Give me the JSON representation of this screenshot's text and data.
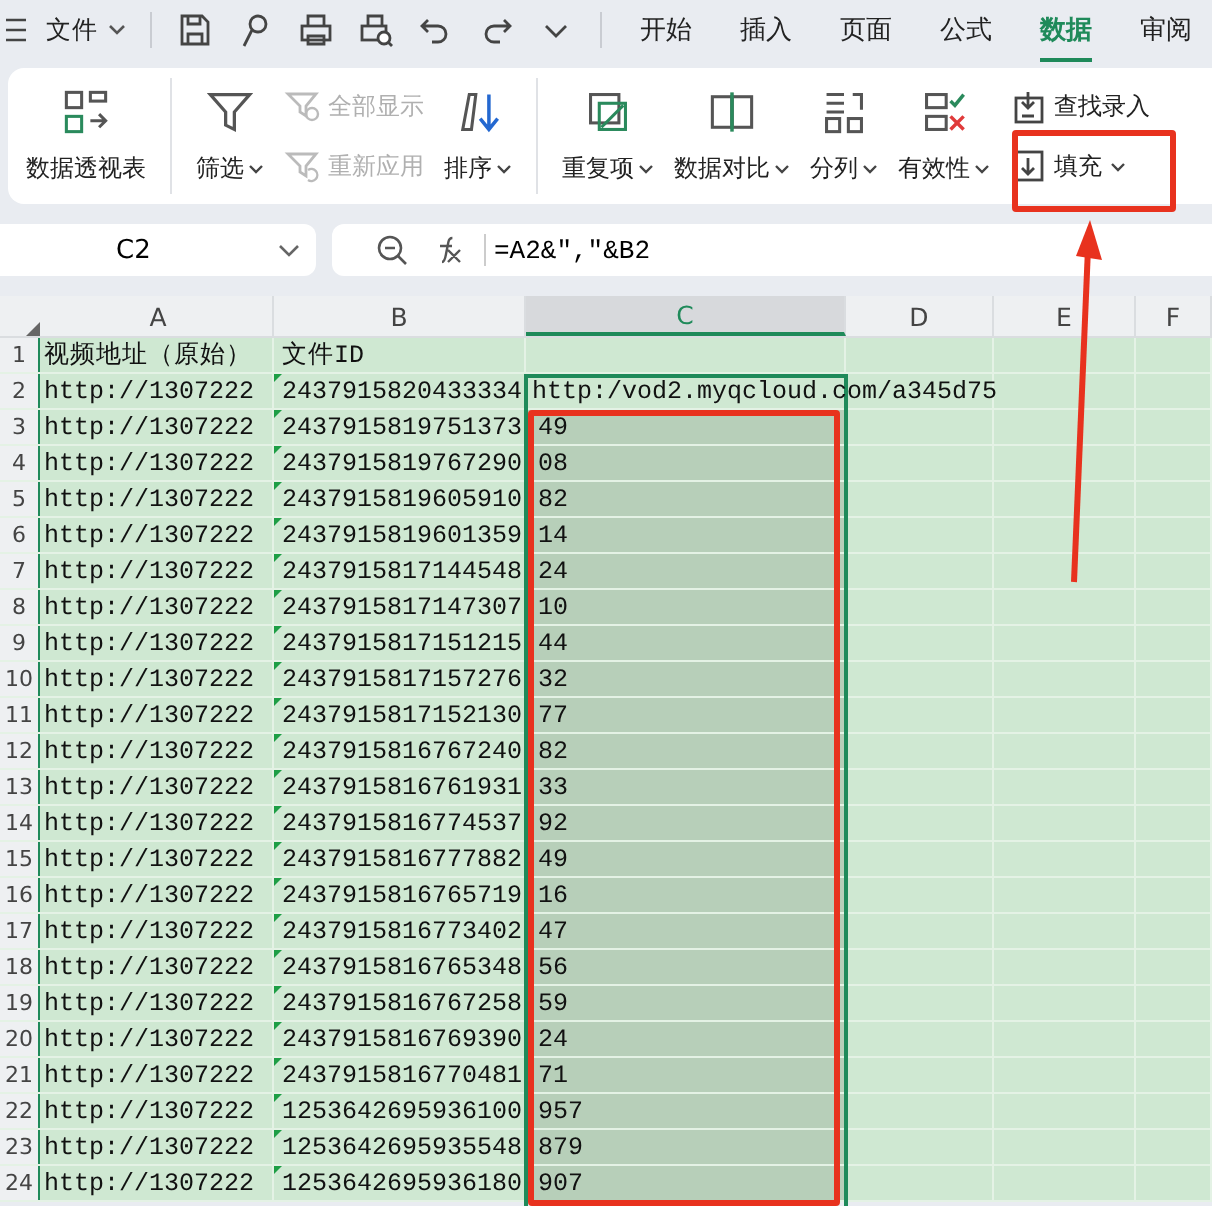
{
  "top_bar": {
    "menu": "文件",
    "tabs": [
      {
        "label": "开始",
        "selected": false
      },
      {
        "label": "插入",
        "selected": false
      },
      {
        "label": "页面",
        "selected": false
      },
      {
        "label": "公式",
        "selected": false
      },
      {
        "label": "数据",
        "selected": true
      },
      {
        "label": "审阅",
        "selected": false
      }
    ]
  },
  "ribbon": {
    "groups": [
      {
        "items": [
          {
            "kind": "large",
            "label": "数据透视表",
            "dropdown": false
          }
        ]
      },
      {
        "items": [
          {
            "kind": "large",
            "label": "筛选",
            "dropdown": true
          },
          {
            "kind": "stack",
            "items": [
              {
                "label": "全部显示",
                "disabled": true,
                "dropdown": false
              },
              {
                "label": "重新应用",
                "disabled": true,
                "dropdown": false
              }
            ]
          },
          {
            "kind": "large",
            "label": "排序",
            "dropdown": true
          }
        ]
      },
      {
        "items": [
          {
            "kind": "large",
            "label": "重复项",
            "dropdown": true
          },
          {
            "kind": "large",
            "label": "数据对比",
            "dropdown": true
          },
          {
            "kind": "large",
            "label": "分列",
            "dropdown": true
          },
          {
            "kind": "large",
            "label": "有效性",
            "dropdown": true
          },
          {
            "kind": "stack",
            "items": [
              {
                "label": "查找录入",
                "disabled": false,
                "dropdown": false
              },
              {
                "label": "填充",
                "disabled": false,
                "dropdown": true
              }
            ]
          }
        ]
      }
    ]
  },
  "formula_bar": {
    "name_box": "C2",
    "formula": "=A2&\",\"&B2"
  },
  "columns": [
    {
      "label": "A",
      "selected": false
    },
    {
      "label": "B",
      "selected": false
    },
    {
      "label": "C",
      "selected": true
    },
    {
      "label": "D",
      "selected": false
    },
    {
      "label": "E",
      "selected": false
    },
    {
      "label": "F",
      "selected": false
    }
  ],
  "rows": [
    {
      "number": "1",
      "a": "视频地址（原始）",
      "b": "文件ID",
      "selected": false
    },
    {
      "number": "2",
      "a": "http://1307222",
      "b": "2437915820433334",
      "c_start": "http:/",
      "c_end": "vod2.myqcloud.com/a345d75",
      "selected": false
    },
    {
      "number": "3",
      "a": "http://1307222",
      "b": "2437915819751373",
      "b_tail": "49",
      "selected": true
    },
    {
      "number": "4",
      "a": "http://1307222",
      "b": "2437915819767290",
      "b_tail": "08",
      "selected": true
    },
    {
      "number": "5",
      "a": "http://1307222",
      "b": "2437915819605910",
      "b_tail": "82",
      "selected": true
    },
    {
      "number": "6",
      "a": "http://1307222",
      "b": "2437915819601359",
      "b_tail": "14",
      "selected": true
    },
    {
      "number": "7",
      "a": "http://1307222",
      "b": "2437915817144548",
      "b_tail": "24",
      "selected": true
    },
    {
      "number": "8",
      "a": "http://1307222",
      "b": "2437915817147307",
      "b_tail": "10",
      "selected": true
    },
    {
      "number": "9",
      "a": "http://1307222",
      "b": "2437915817151215",
      "b_tail": "44",
      "selected": true
    },
    {
      "number": "10",
      "a": "http://1307222",
      "b": "2437915817157276",
      "b_tail": "32",
      "selected": true
    },
    {
      "number": "11",
      "a": "http://1307222",
      "b": "2437915817152130",
      "b_tail": "77",
      "selected": true
    },
    {
      "number": "12",
      "a": "http://1307222",
      "b": "2437915816767240",
      "b_tail": "82",
      "selected": true
    },
    {
      "number": "13",
      "a": "http://1307222",
      "b": "2437915816761931",
      "b_tail": "33",
      "selected": true
    },
    {
      "number": "14",
      "a": "http://1307222",
      "b": "2437915816774537",
      "b_tail": "92",
      "selected": true
    },
    {
      "number": "15",
      "a": "http://1307222",
      "b": "2437915816777882",
      "b_tail": "49",
      "selected": true
    },
    {
      "number": "16",
      "a": "http://1307222",
      "b": "2437915816765719",
      "b_tail": "16",
      "selected": true
    },
    {
      "number": "17",
      "a": "http://1307222",
      "b": "2437915816773402",
      "b_tail": "47",
      "selected": true
    },
    {
      "number": "18",
      "a": "http://1307222",
      "b": "2437915816765348",
      "b_tail": "56",
      "selected": true
    },
    {
      "number": "19",
      "a": "http://1307222",
      "b": "2437915816767258",
      "b_tail": "59",
      "selected": true
    },
    {
      "number": "20",
      "a": "http://1307222",
      "b": "2437915816769390",
      "b_tail": "24",
      "selected": true
    },
    {
      "number": "21",
      "a": "http://1307222",
      "b": "2437915816770481",
      "b_tail": "71",
      "selected": true
    },
    {
      "number": "22",
      "a": "http://1307222",
      "b": "1253642695936100",
      "b_tail": "957",
      "selected": true
    },
    {
      "number": "23",
      "a": "http://1307222",
      "b": "1253642695935548",
      "b_tail": "879",
      "selected": true
    },
    {
      "number": "24",
      "a": "http://1307222",
      "b": "1253642695936180",
      "b_tail": "907",
      "selected": true
    }
  ]
}
